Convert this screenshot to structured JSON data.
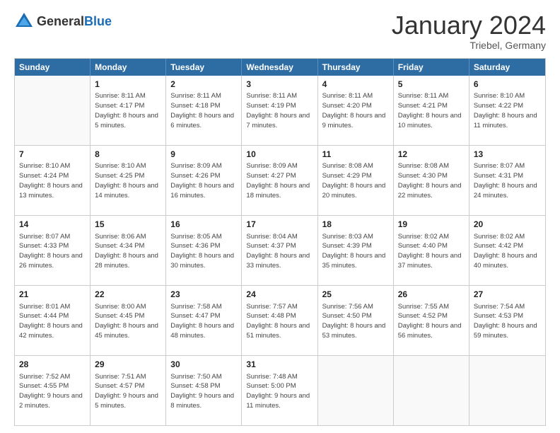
{
  "logo": {
    "general": "General",
    "blue": "Blue"
  },
  "title": "January 2024",
  "location": "Triebel, Germany",
  "header_days": [
    "Sunday",
    "Monday",
    "Tuesday",
    "Wednesday",
    "Thursday",
    "Friday",
    "Saturday"
  ],
  "weeks": [
    [
      {
        "day": "",
        "sunrise": "",
        "sunset": "",
        "daylight": ""
      },
      {
        "day": "1",
        "sunrise": "Sunrise: 8:11 AM",
        "sunset": "Sunset: 4:17 PM",
        "daylight": "Daylight: 8 hours and 5 minutes."
      },
      {
        "day": "2",
        "sunrise": "Sunrise: 8:11 AM",
        "sunset": "Sunset: 4:18 PM",
        "daylight": "Daylight: 8 hours and 6 minutes."
      },
      {
        "day": "3",
        "sunrise": "Sunrise: 8:11 AM",
        "sunset": "Sunset: 4:19 PM",
        "daylight": "Daylight: 8 hours and 7 minutes."
      },
      {
        "day": "4",
        "sunrise": "Sunrise: 8:11 AM",
        "sunset": "Sunset: 4:20 PM",
        "daylight": "Daylight: 8 hours and 9 minutes."
      },
      {
        "day": "5",
        "sunrise": "Sunrise: 8:11 AM",
        "sunset": "Sunset: 4:21 PM",
        "daylight": "Daylight: 8 hours and 10 minutes."
      },
      {
        "day": "6",
        "sunrise": "Sunrise: 8:10 AM",
        "sunset": "Sunset: 4:22 PM",
        "daylight": "Daylight: 8 hours and 11 minutes."
      }
    ],
    [
      {
        "day": "7",
        "sunrise": "Sunrise: 8:10 AM",
        "sunset": "Sunset: 4:24 PM",
        "daylight": "Daylight: 8 hours and 13 minutes."
      },
      {
        "day": "8",
        "sunrise": "Sunrise: 8:10 AM",
        "sunset": "Sunset: 4:25 PM",
        "daylight": "Daylight: 8 hours and 14 minutes."
      },
      {
        "day": "9",
        "sunrise": "Sunrise: 8:09 AM",
        "sunset": "Sunset: 4:26 PM",
        "daylight": "Daylight: 8 hours and 16 minutes."
      },
      {
        "day": "10",
        "sunrise": "Sunrise: 8:09 AM",
        "sunset": "Sunset: 4:27 PM",
        "daylight": "Daylight: 8 hours and 18 minutes."
      },
      {
        "day": "11",
        "sunrise": "Sunrise: 8:08 AM",
        "sunset": "Sunset: 4:29 PM",
        "daylight": "Daylight: 8 hours and 20 minutes."
      },
      {
        "day": "12",
        "sunrise": "Sunrise: 8:08 AM",
        "sunset": "Sunset: 4:30 PM",
        "daylight": "Daylight: 8 hours and 22 minutes."
      },
      {
        "day": "13",
        "sunrise": "Sunrise: 8:07 AM",
        "sunset": "Sunset: 4:31 PM",
        "daylight": "Daylight: 8 hours and 24 minutes."
      }
    ],
    [
      {
        "day": "14",
        "sunrise": "Sunrise: 8:07 AM",
        "sunset": "Sunset: 4:33 PM",
        "daylight": "Daylight: 8 hours and 26 minutes."
      },
      {
        "day": "15",
        "sunrise": "Sunrise: 8:06 AM",
        "sunset": "Sunset: 4:34 PM",
        "daylight": "Daylight: 8 hours and 28 minutes."
      },
      {
        "day": "16",
        "sunrise": "Sunrise: 8:05 AM",
        "sunset": "Sunset: 4:36 PM",
        "daylight": "Daylight: 8 hours and 30 minutes."
      },
      {
        "day": "17",
        "sunrise": "Sunrise: 8:04 AM",
        "sunset": "Sunset: 4:37 PM",
        "daylight": "Daylight: 8 hours and 33 minutes."
      },
      {
        "day": "18",
        "sunrise": "Sunrise: 8:03 AM",
        "sunset": "Sunset: 4:39 PM",
        "daylight": "Daylight: 8 hours and 35 minutes."
      },
      {
        "day": "19",
        "sunrise": "Sunrise: 8:02 AM",
        "sunset": "Sunset: 4:40 PM",
        "daylight": "Daylight: 8 hours and 37 minutes."
      },
      {
        "day": "20",
        "sunrise": "Sunrise: 8:02 AM",
        "sunset": "Sunset: 4:42 PM",
        "daylight": "Daylight: 8 hours and 40 minutes."
      }
    ],
    [
      {
        "day": "21",
        "sunrise": "Sunrise: 8:01 AM",
        "sunset": "Sunset: 4:44 PM",
        "daylight": "Daylight: 8 hours and 42 minutes."
      },
      {
        "day": "22",
        "sunrise": "Sunrise: 8:00 AM",
        "sunset": "Sunset: 4:45 PM",
        "daylight": "Daylight: 8 hours and 45 minutes."
      },
      {
        "day": "23",
        "sunrise": "Sunrise: 7:58 AM",
        "sunset": "Sunset: 4:47 PM",
        "daylight": "Daylight: 8 hours and 48 minutes."
      },
      {
        "day": "24",
        "sunrise": "Sunrise: 7:57 AM",
        "sunset": "Sunset: 4:48 PM",
        "daylight": "Daylight: 8 hours and 51 minutes."
      },
      {
        "day": "25",
        "sunrise": "Sunrise: 7:56 AM",
        "sunset": "Sunset: 4:50 PM",
        "daylight": "Daylight: 8 hours and 53 minutes."
      },
      {
        "day": "26",
        "sunrise": "Sunrise: 7:55 AM",
        "sunset": "Sunset: 4:52 PM",
        "daylight": "Daylight: 8 hours and 56 minutes."
      },
      {
        "day": "27",
        "sunrise": "Sunrise: 7:54 AM",
        "sunset": "Sunset: 4:53 PM",
        "daylight": "Daylight: 8 hours and 59 minutes."
      }
    ],
    [
      {
        "day": "28",
        "sunrise": "Sunrise: 7:52 AM",
        "sunset": "Sunset: 4:55 PM",
        "daylight": "Daylight: 9 hours and 2 minutes."
      },
      {
        "day": "29",
        "sunrise": "Sunrise: 7:51 AM",
        "sunset": "Sunset: 4:57 PM",
        "daylight": "Daylight: 9 hours and 5 minutes."
      },
      {
        "day": "30",
        "sunrise": "Sunrise: 7:50 AM",
        "sunset": "Sunset: 4:58 PM",
        "daylight": "Daylight: 9 hours and 8 minutes."
      },
      {
        "day": "31",
        "sunrise": "Sunrise: 7:48 AM",
        "sunset": "Sunset: 5:00 PM",
        "daylight": "Daylight: 9 hours and 11 minutes."
      },
      {
        "day": "",
        "sunrise": "",
        "sunset": "",
        "daylight": ""
      },
      {
        "day": "",
        "sunrise": "",
        "sunset": "",
        "daylight": ""
      },
      {
        "day": "",
        "sunrise": "",
        "sunset": "",
        "daylight": ""
      }
    ]
  ]
}
